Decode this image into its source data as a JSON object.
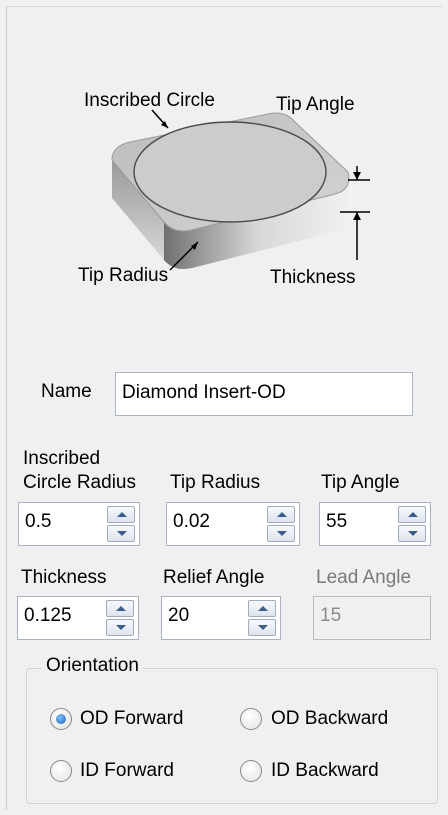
{
  "diagram": {
    "inscribed_circle": "Inscribed Circle",
    "tip_angle": "Tip Angle",
    "tip_radius": "Tip Radius",
    "thickness": "Thickness"
  },
  "form": {
    "name_label": "Name",
    "name_value": "Diamond Insert-OD",
    "inscribed_circle_radius_label_line1": "Inscribed",
    "inscribed_circle_radius_label_line2": "Circle Radius",
    "inscribed_circle_radius_value": "0.5",
    "tip_radius_label": "Tip Radius",
    "tip_radius_value": "0.02",
    "tip_angle_label": "Tip Angle",
    "tip_angle_value": "55",
    "thickness_label": "Thickness",
    "thickness_value": "0.125",
    "relief_angle_label": "Relief Angle",
    "relief_angle_value": "20",
    "lead_angle_label": "Lead Angle",
    "lead_angle_value": "15"
  },
  "orientation": {
    "legend": "Orientation",
    "options": [
      {
        "label": "OD Forward",
        "checked": true
      },
      {
        "label": "OD Backward",
        "checked": false
      },
      {
        "label": "ID Forward",
        "checked": false
      },
      {
        "label": "ID Backward",
        "checked": false
      }
    ]
  }
}
